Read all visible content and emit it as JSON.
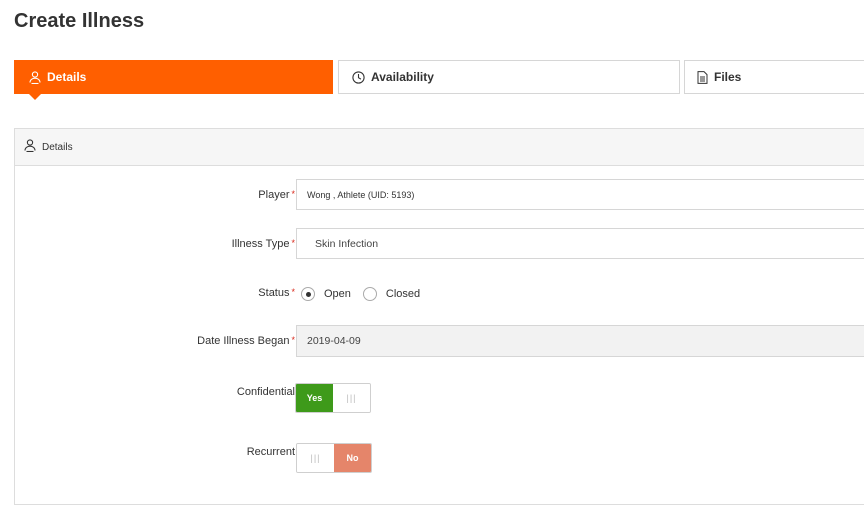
{
  "page": {
    "title": "Create Illness"
  },
  "tabs": [
    {
      "label": "Details",
      "icon": "user-group-icon",
      "active": true
    },
    {
      "label": "Availability",
      "icon": "clock-icon",
      "active": false
    },
    {
      "label": "Files",
      "icon": "file-icon",
      "active": false
    }
  ],
  "section": {
    "title": "Details",
    "icon": "user-group-icon"
  },
  "form": {
    "player": {
      "label": "Player",
      "required_mark": "*",
      "value": "Wong , Athlete (UID: 5193)"
    },
    "illness_type": {
      "label": "Illness Type",
      "required_mark": "*",
      "value": "Skin Infection"
    },
    "status": {
      "label": "Status",
      "required_mark": "*",
      "options": [
        "Open",
        "Closed"
      ],
      "selected": "Open"
    },
    "date_began": {
      "label": "Date Illness Began",
      "required_mark": "*",
      "value": "2019-04-09"
    },
    "confidential": {
      "label": "Confidential",
      "yes_label": "Yes",
      "handle": "|||",
      "value": "Yes"
    },
    "recurrent": {
      "label": "Recurrent",
      "no_label": "No",
      "handle": "|||",
      "value": "No"
    }
  },
  "colors": {
    "accent": "#ff5f00",
    "toggle_yes": "#3e9a1a",
    "toggle_no": "#e5856a",
    "required": "#d9281b"
  }
}
